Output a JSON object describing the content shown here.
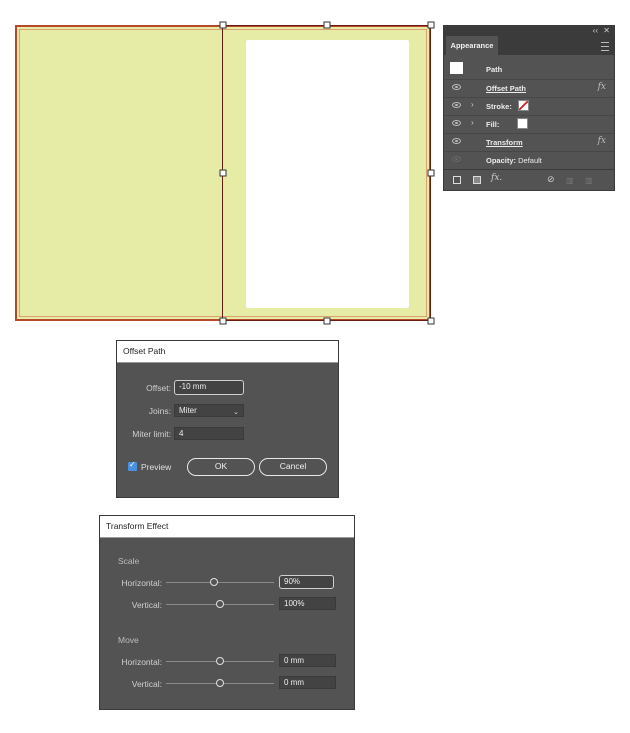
{
  "appearance": {
    "tab": "Appearance",
    "collapse_icon": "double-chevron-icon",
    "close_icon": "close-icon",
    "path_label": "Path",
    "rows": [
      {
        "label": "Offset Path",
        "fx": "fx"
      },
      {
        "label": "Stroke:"
      },
      {
        "label": "Fill:"
      },
      {
        "label": "Transform",
        "fx": "fx"
      },
      {
        "label": "Opacity:",
        "value": "Default"
      }
    ],
    "bottom_fx": "fx."
  },
  "offset_dialog": {
    "title": "Offset Path",
    "offset_label": "Offset:",
    "offset_value": "-10 mm",
    "joins_label": "Joins:",
    "joins_value": "Miter",
    "miter_label": "Miter limit:",
    "miter_value": "4",
    "preview_label": "Preview",
    "ok_label": "OK",
    "cancel_label": "Cancel"
  },
  "transform_dialog": {
    "title": "Transform Effect",
    "scale_section": "Scale",
    "scale_h_label": "Horizontal:",
    "scale_h_value": "90%",
    "scale_v_label": "Vertical:",
    "scale_v_value": "100%",
    "move_section": "Move",
    "move_h_label": "Horizontal:",
    "move_h_value": "0 mm",
    "move_v_label": "Vertical:",
    "move_v_value": "0 mm"
  },
  "colors": {
    "artboard_fill": "#e6eba5",
    "artboard_stroke": "#b9472a",
    "panel_bg": "#535353",
    "checkbox": "#4a90e2"
  }
}
